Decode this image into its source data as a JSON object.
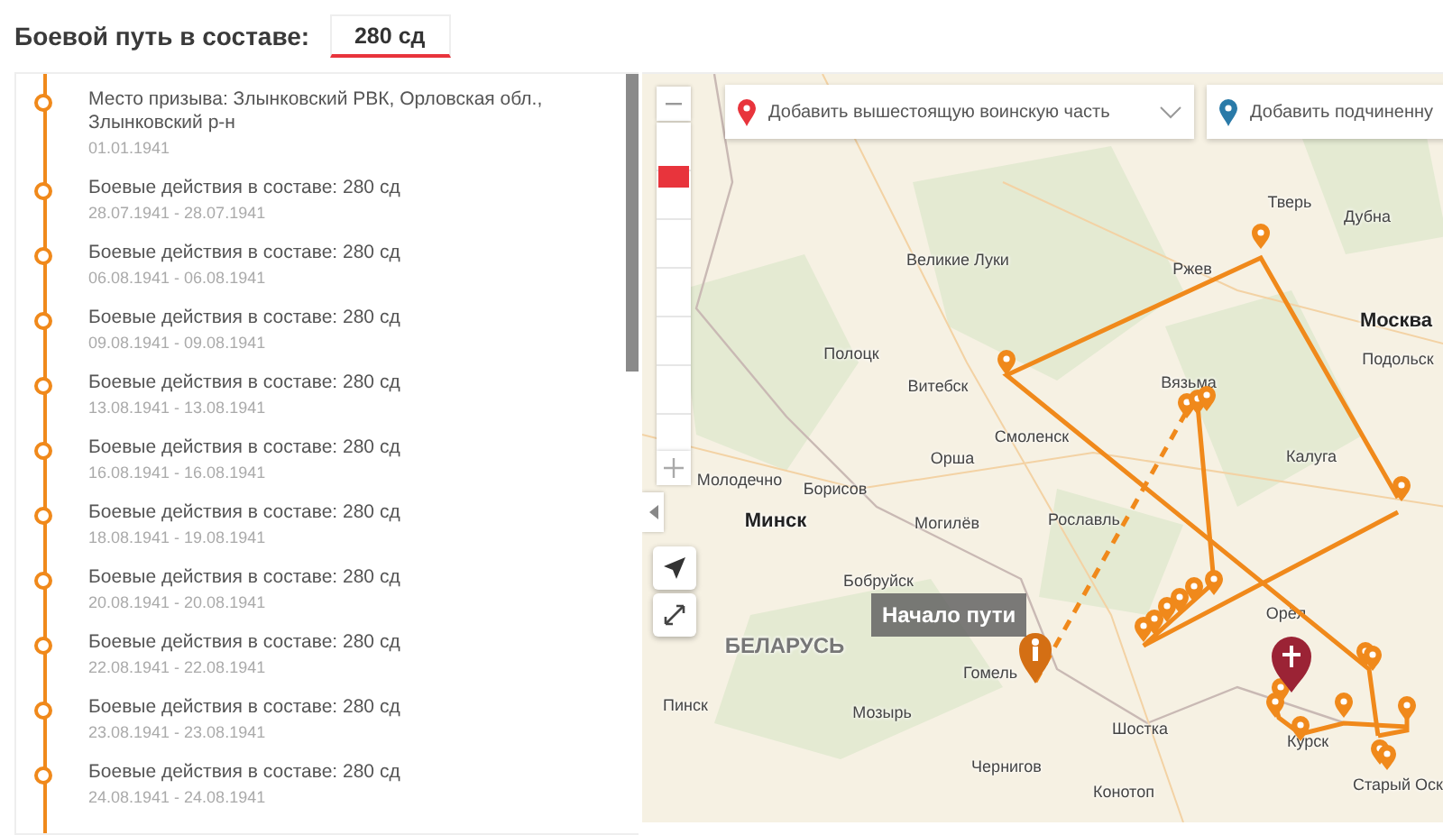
{
  "header": {
    "label": "Боевой путь в составе:",
    "value": "280 сд"
  },
  "timeline": [
    {
      "title": "Место призыва: Злынковский РВК, Орловская обл., Злынковский р-н",
      "date": "01.01.1941"
    },
    {
      "title": "Боевые действия в составе: 280 сд",
      "date": "28.07.1941 - 28.07.1941"
    },
    {
      "title": "Боевые действия в составе: 280 сд",
      "date": "06.08.1941 - 06.08.1941"
    },
    {
      "title": "Боевые действия в составе: 280 сд",
      "date": "09.08.1941 - 09.08.1941"
    },
    {
      "title": "Боевые действия в составе: 280 сд",
      "date": "13.08.1941 - 13.08.1941"
    },
    {
      "title": "Боевые действия в составе: 280 сд",
      "date": "16.08.1941 - 16.08.1941"
    },
    {
      "title": "Боевые действия в составе: 280 сд",
      "date": "18.08.1941 - 19.08.1941"
    },
    {
      "title": "Боевые действия в составе: 280 сд",
      "date": "20.08.1941 - 20.08.1941"
    },
    {
      "title": "Боевые действия в составе: 280 сд",
      "date": "22.08.1941 - 22.08.1941"
    },
    {
      "title": "Боевые действия в составе: 280 сд",
      "date": "23.08.1941 - 23.08.1941"
    },
    {
      "title": "Боевые действия в составе: 280 сд",
      "date": "24.08.1941 - 24.08.1941"
    }
  ],
  "map": {
    "zoom_slider": {
      "level": 0.86
    },
    "dropdowns": [
      {
        "kind": "superior",
        "text": "Добавить вышестоящую воинскую часть"
      },
      {
        "kind": "subordinate",
        "text": "Добавить подчиненну"
      }
    ],
    "start_label": "Начало пути",
    "places": [
      {
        "kind": "city",
        "name": "Тверь"
      },
      {
        "kind": "city",
        "name": "Дубна"
      },
      {
        "kind": "city",
        "name": "Великие Луки"
      },
      {
        "kind": "city",
        "name": "Ржев"
      },
      {
        "kind": "capital",
        "name": "Москва"
      },
      {
        "kind": "city",
        "name": "Подольск"
      },
      {
        "kind": "city",
        "name": "Полоцк"
      },
      {
        "kind": "city",
        "name": "Витебск"
      },
      {
        "kind": "city",
        "name": "Вязьма"
      },
      {
        "kind": "city",
        "name": "Смоленск"
      },
      {
        "kind": "city",
        "name": "Орша"
      },
      {
        "kind": "city",
        "name": "Калуга"
      },
      {
        "kind": "city",
        "name": "Молодечно"
      },
      {
        "kind": "city",
        "name": "Борисов"
      },
      {
        "kind": "capital",
        "name": "Минск"
      },
      {
        "kind": "city",
        "name": "Могилёв"
      },
      {
        "kind": "city",
        "name": "Рославль"
      },
      {
        "kind": "city",
        "name": "Бобруйск"
      },
      {
        "kind": "country",
        "name": "БЕЛАРУСЬ"
      },
      {
        "kind": "city",
        "name": "Орёл"
      },
      {
        "kind": "city",
        "name": "Гомель"
      },
      {
        "kind": "city",
        "name": "Пинск"
      },
      {
        "kind": "city",
        "name": "Мозырь"
      },
      {
        "kind": "city",
        "name": "Шостка"
      },
      {
        "kind": "city",
        "name": "Чернигов"
      },
      {
        "kind": "city",
        "name": "Курск"
      },
      {
        "kind": "city",
        "name": "Конотоп"
      },
      {
        "kind": "city",
        "name": "Старый Оск"
      }
    ]
  }
}
